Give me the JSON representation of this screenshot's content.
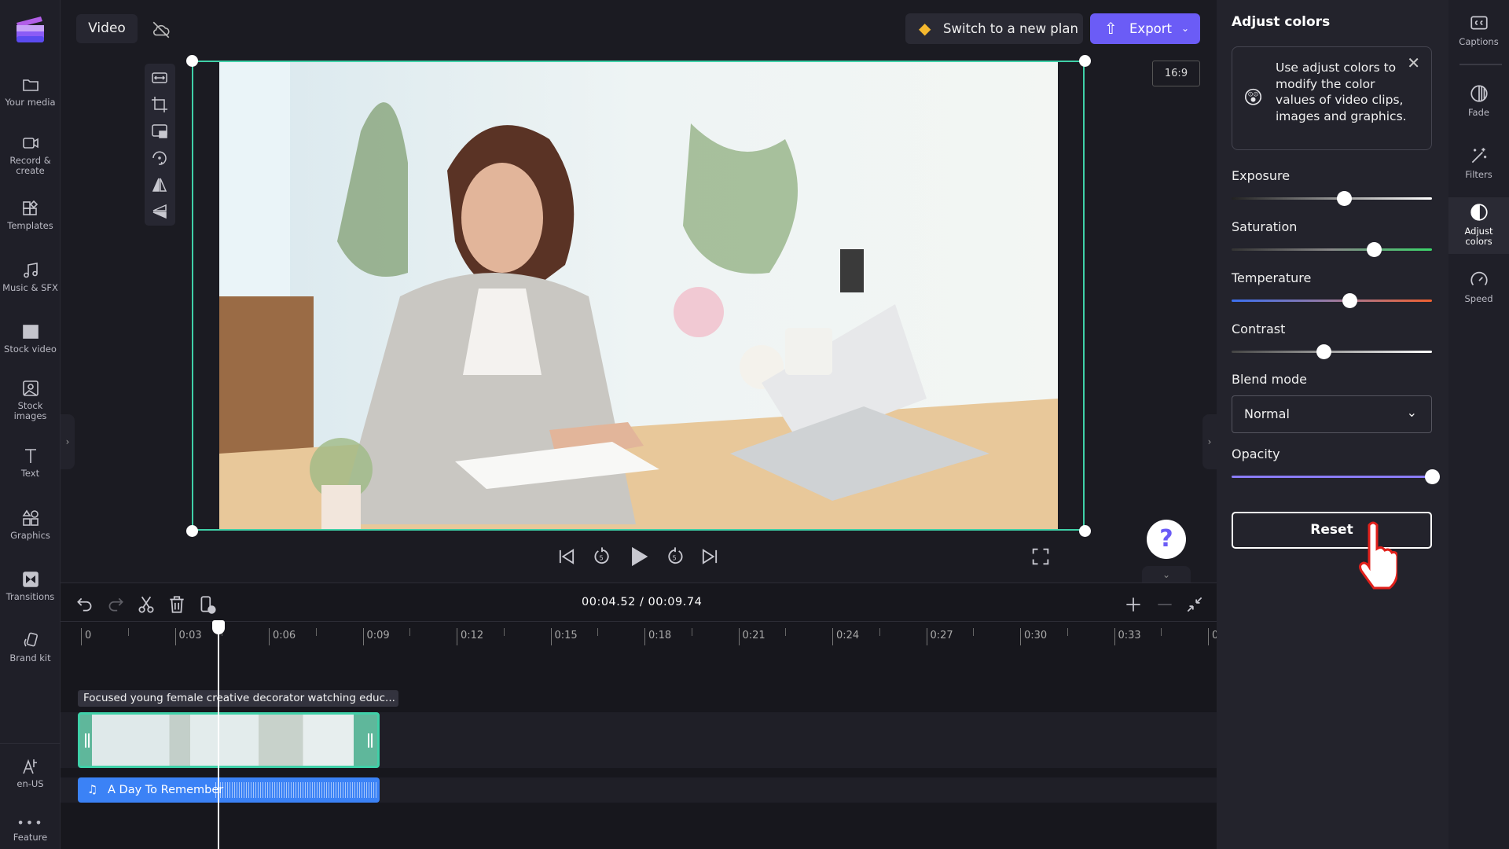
{
  "sidebar": {
    "items": [
      {
        "label": "Your media",
        "icon": "folder-icon"
      },
      {
        "label": "Record & create",
        "icon": "camera-icon"
      },
      {
        "label": "Templates",
        "icon": "templates-icon"
      },
      {
        "label": "Music & SFX",
        "icon": "music-icon"
      },
      {
        "label": "Stock video",
        "icon": "film-icon"
      },
      {
        "label": "Stock images",
        "icon": "image-icon"
      },
      {
        "label": "Text",
        "icon": "text-icon"
      },
      {
        "label": "Graphics",
        "icon": "shapes-icon"
      },
      {
        "label": "Transitions",
        "icon": "transition-icon"
      },
      {
        "label": "Brand kit",
        "icon": "brand-kit-icon"
      }
    ],
    "language": "en-US",
    "feature": "Feature"
  },
  "topbar": {
    "project_name": "Video",
    "switch_plan": "Switch to a new plan",
    "export": "Export"
  },
  "preview": {
    "aspect_ratio": "16:9"
  },
  "timeline": {
    "current_time": "00:04.52",
    "total_time": "00:09.74",
    "separator": "/",
    "ruler": [
      "0",
      "0:03",
      "0:06",
      "0:09",
      "0:12",
      "0:15",
      "0:18",
      "0:21",
      "0:24",
      "0:27",
      "0:30",
      "0:33",
      "0"
    ],
    "video_clip_title": "Focused young female creative decorator watching educ...",
    "audio_clip_title": "A Day To Remember"
  },
  "panel": {
    "title": "Adjust colors",
    "tip": "Use adjust colors to modify the color values of video clips, images and graphics.",
    "sliders": [
      {
        "label": "Exposure",
        "value": 0.56
      },
      {
        "label": "Saturation",
        "value": 0.71
      },
      {
        "label": "Temperature",
        "value": 0.59
      },
      {
        "label": "Contrast",
        "value": 0.46
      }
    ],
    "blend_label": "Blend mode",
    "blend_value": "Normal",
    "opacity_label": "Opacity",
    "opacity_value": 1.0,
    "reset": "Reset"
  },
  "rail": {
    "items": [
      "Captions",
      "Fade",
      "Filters",
      "Adjust colors",
      "Speed"
    ],
    "active": "Adjust colors"
  },
  "colors": {
    "accent": "#6b5cf6",
    "selection": "#3fd0a8",
    "audio": "#3b82f6"
  }
}
